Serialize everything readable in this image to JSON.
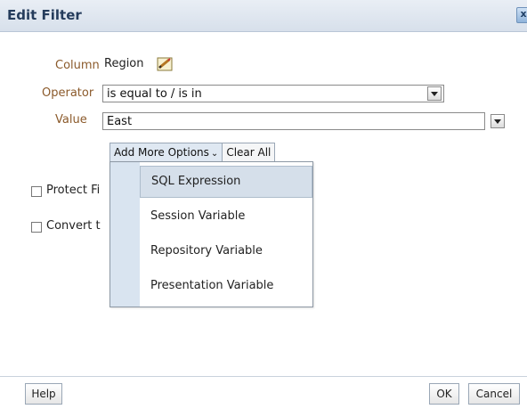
{
  "dialog": {
    "title": "Edit Filter",
    "close_label": "x"
  },
  "form": {
    "column_label": "Column",
    "column_value": "Region",
    "operator_label": "Operator",
    "operator_value": "is equal to / is in",
    "value_label": "Value",
    "value_value": "East"
  },
  "buttons": {
    "add_more_options": "Add More Options",
    "clear_all": "Clear All",
    "help": "Help",
    "ok": "OK",
    "cancel": "Cancel"
  },
  "menu": {
    "items": [
      "SQL Expression",
      "Session Variable",
      "Repository Variable",
      "Presentation Variable"
    ]
  },
  "options": {
    "protect_filter_partial": "Protect Fi",
    "convert_partial": "Convert t"
  },
  "icons": {
    "pencil": "edit-pencil-icon",
    "dropdown": "chevron-down-icon",
    "close": "close-icon"
  },
  "colors": {
    "label": "#8b5a2b",
    "title": "#253c5c",
    "menu_highlight": "#d5dfea"
  }
}
